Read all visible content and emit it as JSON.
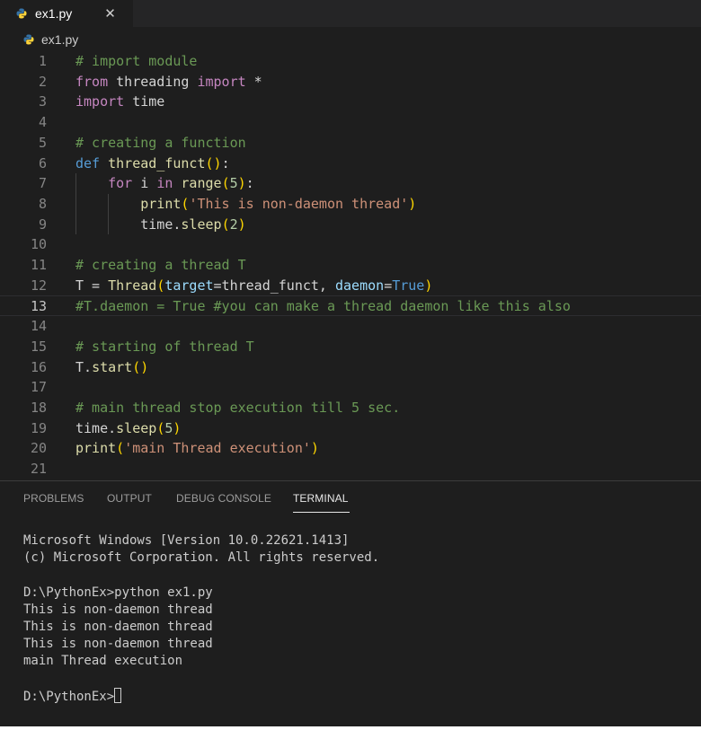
{
  "tab": {
    "filename": "ex1.py",
    "close_glyph": "✕"
  },
  "breadcrumb": {
    "filename": "ex1.py"
  },
  "colors": {
    "python_blue": "#3572a5",
    "python_yellow": "#ffd43b",
    "editor_bg": "#1e1e1e"
  },
  "editor": {
    "current_line": 13,
    "lines": [
      {
        "n": "1",
        "tokens": [
          [
            "cm",
            "# import module"
          ]
        ]
      },
      {
        "n": "2",
        "tokens": [
          [
            "kw",
            "from"
          ],
          [
            "txt",
            " threading "
          ],
          [
            "kw",
            "import"
          ],
          [
            "txt",
            " *"
          ]
        ]
      },
      {
        "n": "3",
        "tokens": [
          [
            "kw",
            "import"
          ],
          [
            "txt",
            " time"
          ]
        ]
      },
      {
        "n": "4",
        "tokens": []
      },
      {
        "n": "5",
        "tokens": [
          [
            "cm",
            "# creating a function"
          ]
        ]
      },
      {
        "n": "6",
        "tokens": [
          [
            "def",
            "def"
          ],
          [
            "txt",
            " "
          ],
          [
            "fn",
            "thread_funct"
          ],
          [
            "br",
            "()"
          ],
          [
            "txt",
            ":"
          ]
        ]
      },
      {
        "n": "7",
        "tokens": [
          [
            "txt",
            "    "
          ],
          [
            "kw",
            "for"
          ],
          [
            "txt",
            " i "
          ],
          [
            "kw",
            "in"
          ],
          [
            "txt",
            " "
          ],
          [
            "fn",
            "range"
          ],
          [
            "br",
            "("
          ],
          [
            "num",
            "5"
          ],
          [
            "br",
            ")"
          ],
          [
            "txt",
            ":"
          ]
        ]
      },
      {
        "n": "8",
        "tokens": [
          [
            "txt",
            "        "
          ],
          [
            "fn",
            "print"
          ],
          [
            "br",
            "("
          ],
          [
            "str",
            "'This is non-daemon thread'"
          ],
          [
            "br",
            ")"
          ]
        ]
      },
      {
        "n": "9",
        "tokens": [
          [
            "txt",
            "        time."
          ],
          [
            "fn",
            "sleep"
          ],
          [
            "br",
            "("
          ],
          [
            "num",
            "2"
          ],
          [
            "br",
            ")"
          ]
        ]
      },
      {
        "n": "10",
        "tokens": []
      },
      {
        "n": "11",
        "tokens": [
          [
            "cm",
            "# creating a thread T"
          ]
        ]
      },
      {
        "n": "12",
        "tokens": [
          [
            "txt",
            "T = "
          ],
          [
            "fn",
            "Thread"
          ],
          [
            "br",
            "("
          ],
          [
            "param",
            "target"
          ],
          [
            "txt",
            "=thread_funct, "
          ],
          [
            "param",
            "daemon"
          ],
          [
            "txt",
            "="
          ],
          [
            "const",
            "True"
          ],
          [
            "br",
            ")"
          ]
        ]
      },
      {
        "n": "13",
        "tokens": [
          [
            "cm",
            "#T.daemon = True #you can make a thread daemon like this also"
          ]
        ]
      },
      {
        "n": "14",
        "tokens": []
      },
      {
        "n": "15",
        "tokens": [
          [
            "cm",
            "# starting of thread T"
          ]
        ]
      },
      {
        "n": "16",
        "tokens": [
          [
            "txt",
            "T."
          ],
          [
            "fn",
            "start"
          ],
          [
            "br",
            "()"
          ]
        ]
      },
      {
        "n": "17",
        "tokens": []
      },
      {
        "n": "18",
        "tokens": [
          [
            "cm",
            "# main thread stop execution till 5 sec."
          ]
        ]
      },
      {
        "n": "19",
        "tokens": [
          [
            "txt",
            "time."
          ],
          [
            "fn",
            "sleep"
          ],
          [
            "br",
            "("
          ],
          [
            "num",
            "5"
          ],
          [
            "br",
            ")"
          ]
        ]
      },
      {
        "n": "20",
        "tokens": [
          [
            "fn",
            "print"
          ],
          [
            "br",
            "("
          ],
          [
            "str",
            "'main Thread execution'"
          ],
          [
            "br",
            ")"
          ]
        ]
      },
      {
        "n": "21",
        "tokens": []
      }
    ]
  },
  "panel": {
    "tabs": [
      {
        "label": "PROBLEMS",
        "active": false
      },
      {
        "label": "OUTPUT",
        "active": false
      },
      {
        "label": "DEBUG CONSOLE",
        "active": false
      },
      {
        "label": "TERMINAL",
        "active": true
      }
    ]
  },
  "terminal": {
    "lines": [
      "Microsoft Windows [Version 10.0.22621.1413]",
      "(c) Microsoft Corporation. All rights reserved.",
      "",
      "D:\\PythonEx>python ex1.py",
      "This is non-daemon thread",
      "This is non-daemon thread",
      "This is non-daemon thread",
      "main Thread execution",
      ""
    ],
    "prompt": "D:\\PythonEx>"
  }
}
